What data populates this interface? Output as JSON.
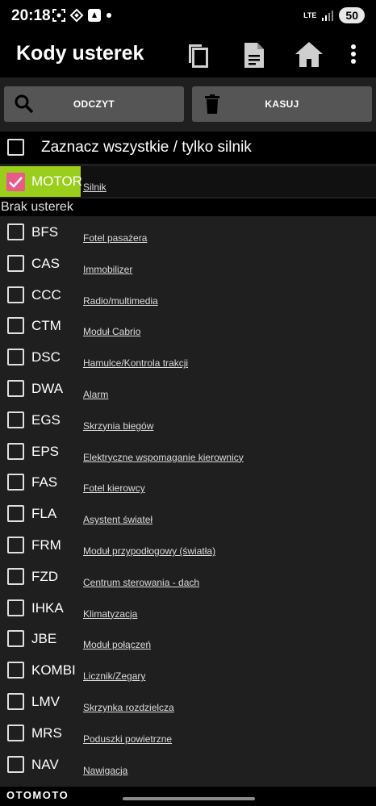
{
  "status_bar": {
    "time": "20:18",
    "network": "LTE",
    "battery": "50"
  },
  "app_bar": {
    "title": "Kody usterek"
  },
  "buttons": {
    "read_label": "ODCZYT",
    "clear_label": "KASUJ"
  },
  "select_all": {
    "label": "Zaznacz wszystkie / tylko silnik",
    "checked": false
  },
  "motor": {
    "code": "MOTOR",
    "description": "Silnik",
    "checked": true,
    "chip_color": "#9acd1c",
    "check_color": "#e85a8a"
  },
  "section_header": "Brak usterek",
  "modules": [
    {
      "code": "BFS",
      "description": "Fotel pasażera"
    },
    {
      "code": "CAS",
      "description": "Immobilizer"
    },
    {
      "code": "CCC",
      "description": "Radio/multimedia"
    },
    {
      "code": "CTM",
      "description": "Moduł Cabrio"
    },
    {
      "code": "DSC",
      "description": "Hamulce/Kontrola trakcji"
    },
    {
      "code": "DWA",
      "description": "Alarm"
    },
    {
      "code": "EGS",
      "description": "Skrzynia biegów"
    },
    {
      "code": "EPS",
      "description": "Elektryczne wspomaganie kierownicy"
    },
    {
      "code": "FAS",
      "description": "Fotel kierowcy"
    },
    {
      "code": "FLA",
      "description": "Asystent świateł"
    },
    {
      "code": "FRM",
      "description": "Moduł przypodłogowy (światła)"
    },
    {
      "code": "FZD",
      "description": "Centrum sterowania - dach"
    },
    {
      "code": "IHKA",
      "description": "Klimatyzacja"
    },
    {
      "code": "JBE",
      "description": "Moduł połączeń"
    },
    {
      "code": "KOMBI",
      "description": "Licznik/Zegary"
    },
    {
      "code": "LMV",
      "description": "Skrzynka rozdzielcza"
    },
    {
      "code": "MRS",
      "description": "Poduszki powietrzne"
    },
    {
      "code": "NAV",
      "description": "Nawigacja"
    }
  ],
  "watermark": "OTOMOTO"
}
